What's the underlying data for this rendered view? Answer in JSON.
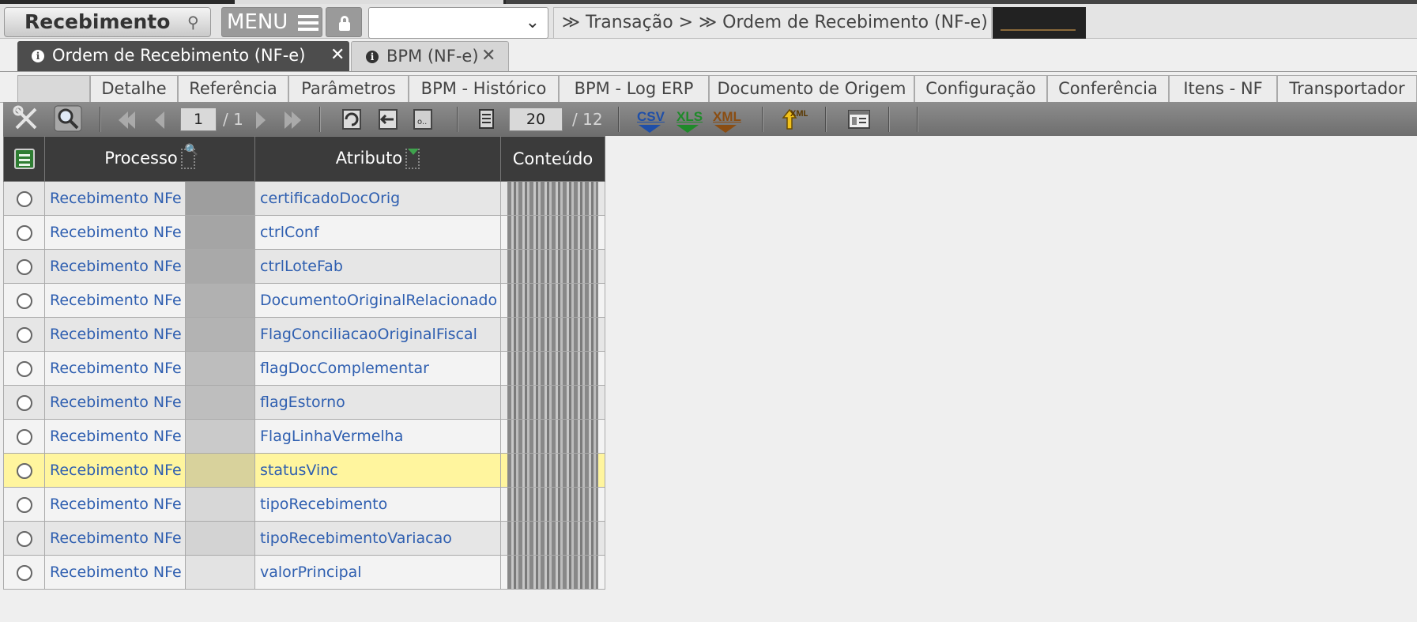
{
  "app": {
    "title": "Recebimento",
    "menu_label": "MENU",
    "select_value": "",
    "breadcrumb": "≫ Transação > ≫ Ordem de Recebimento (NF-e) >"
  },
  "doc_tabs": [
    {
      "label": "Ordem de Recebimento (NF-e)",
      "active": true
    },
    {
      "label": "BPM (NF-e)",
      "active": false
    }
  ],
  "sub_tabs": [
    "Detalhe",
    "Referência",
    "Parâmetros",
    "BPM - Histórico",
    "BPM - Log ERP",
    "Documento de Origem",
    "Configuração",
    "Conferência",
    "Itens - NF",
    "Transportador"
  ],
  "toolbar": {
    "page_current": "1",
    "page_total": "/ 1",
    "page_size": "20",
    "record_total": "/ 12",
    "export_csv": "CSV",
    "export_xls": "XLS",
    "export_xml": "XML",
    "import_xml": "XML"
  },
  "table": {
    "headers": {
      "processo": "Processo",
      "atributo": "Atributo",
      "conteudo": "Conteúdo"
    },
    "rows": [
      {
        "processo": "Recebimento NFe",
        "atributo": "certificadoDocOrig"
      },
      {
        "processo": "Recebimento NFe",
        "atributo": "ctrlConf"
      },
      {
        "processo": "Recebimento NFe",
        "atributo": "ctrlLoteFab"
      },
      {
        "processo": "Recebimento NFe",
        "atributo": "DocumentoOriginalRelacionado"
      },
      {
        "processo": "Recebimento NFe",
        "atributo": "FlagConciliacaoOriginalFiscal"
      },
      {
        "processo": "Recebimento NFe",
        "atributo": "flagDocComplementar"
      },
      {
        "processo": "Recebimento NFe",
        "atributo": "flagEstorno"
      },
      {
        "processo": "Recebimento NFe",
        "atributo": "FlagLinhaVermelha"
      },
      {
        "processo": "Recebimento NFe",
        "atributo": "statusVinc"
      },
      {
        "processo": "Recebimento NFe",
        "atributo": "tipoRecebimento"
      },
      {
        "processo": "Recebimento NFe",
        "atributo": "tipoRecebimentoVariacao"
      },
      {
        "processo": "Recebimento NFe",
        "atributo": "valorPrincipal"
      }
    ],
    "selected_row": 8
  },
  "colors": {
    "header_dark": "#3b3b3b",
    "link_blue": "#2f5fb0",
    "selected_row": "#fff59e",
    "csv": "#1f4fa8",
    "xls": "#1f8a2a",
    "xml": "#8a4d12"
  },
  "icons": [
    "pin-icon",
    "hamburger-icon",
    "lock-icon",
    "chevron-down-icon",
    "info-icon",
    "close-icon",
    "tools-icon",
    "search-icon",
    "first-page-icon",
    "prev-page-icon",
    "next-page-icon",
    "last-page-icon",
    "refresh-icon",
    "export-page-icon",
    "field-icon",
    "page-size-icon",
    "csv-icon",
    "xls-icon",
    "xml-icon",
    "import-xml-icon",
    "form-view-icon",
    "column-list-icon",
    "radio-icon"
  ]
}
